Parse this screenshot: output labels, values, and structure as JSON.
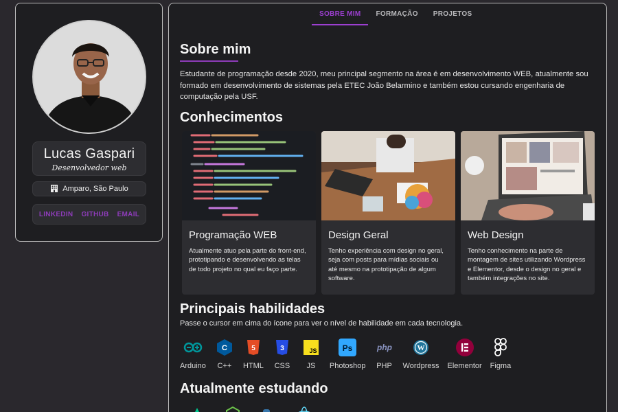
{
  "profile": {
    "name": "Lucas Gaspari",
    "role": "Desenvolvedor web",
    "location": "Amparo, São Paulo",
    "links": [
      "LINKEDIN",
      "GITHUB",
      "EMAIL"
    ]
  },
  "nav": {
    "tabs": [
      "SOBRE MIM",
      "FORMAÇÃO",
      "PROJETOS"
    ],
    "active": "SOBRE MIM"
  },
  "about": {
    "title": "Sobre mim",
    "text": "Estudante de programação desde 2020, meu principal segmento na área é em desenvolvimento WEB, atualmente sou formado em desenvolvimento de sistemas pela ETEC João Belarmino e também estou cursando engenharia de computação pela USF."
  },
  "knowledge": {
    "title": "Conhecimentos",
    "cards": [
      {
        "title": "Programação WEB",
        "text": "Atualmente atuo pela parte do front-end, prototipando e desenvolvendo as telas de todo projeto no qual eu faço parte."
      },
      {
        "title": "Design Geral",
        "text": "Tenho experiência com design no geral, seja com posts para mídias sociais ou até mesmo na prototipação de algum software."
      },
      {
        "title": "Web Design",
        "text": "Tenho conhecimento na parte de montagem de sites utilizando Wordpress e Elementor, desde o design no geral e também integrações no site."
      }
    ]
  },
  "skills": {
    "title": "Principais habilidades",
    "hint": "Passe o cursor em cima do ícone para ver o nível de habilidade em cada tecnologia.",
    "items": [
      {
        "label": "Arduino",
        "icon": "arduino-icon"
      },
      {
        "label": "C++",
        "icon": "cpp-icon"
      },
      {
        "label": "HTML",
        "icon": "html-icon"
      },
      {
        "label": "CSS",
        "icon": "css-icon"
      },
      {
        "label": "JS",
        "icon": "js-icon"
      },
      {
        "label": "Photoshop",
        "icon": "photoshop-icon"
      },
      {
        "label": "PHP",
        "icon": "php-icon"
      },
      {
        "label": "Wordpress",
        "icon": "wordpress-icon"
      },
      {
        "label": "Elementor",
        "icon": "elementor-icon"
      },
      {
        "label": "Figma",
        "icon": "figma-icon"
      }
    ]
  },
  "studying": {
    "title": "Atualmente estudando"
  },
  "colors": {
    "accent": "#9c3fd0",
    "background": "#2a282d",
    "panel": "#1e1e21",
    "card": "#2d2d31"
  }
}
